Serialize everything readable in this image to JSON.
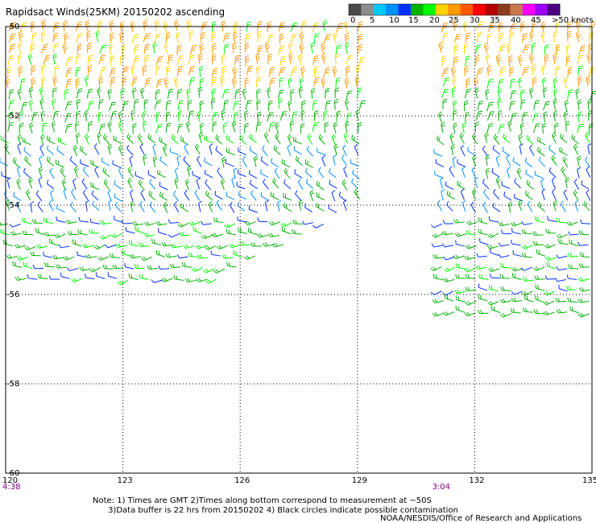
{
  "title": "Rapidsact Winds(25KM) 20150202 ascending",
  "legend": {
    "colors": [
      "#4a4a4a",
      "#8c8c8c",
      "#00c8ff",
      "#0090ff",
      "#0030ff",
      "#00b400",
      "#00ff00",
      "#ffd200",
      "#ff9a00",
      "#ff5a00",
      "#ff0000",
      "#b40000",
      "#8c3c1e",
      "#c87850",
      "#ff00ff",
      "#a000ff",
      "#4b0082"
    ],
    "labels": [
      "0",
      "5",
      "10",
      "15",
      "20",
      "25",
      "30",
      "35",
      "40",
      "45",
      ">50 knots"
    ]
  },
  "axes": {
    "lat_labels": [
      "-50",
      "-52",
      "-54",
      "-56",
      "-58",
      "-60"
    ],
    "lon_labels": [
      "120",
      "123",
      "126",
      "129",
      "132",
      "135"
    ]
  },
  "times": [
    "4:38",
    "3:04"
  ],
  "note_lines": [
    "Note: 1) Times are GMT 2)Times along bottom correspond to measurement at ~50S",
    "      3)Data buffer is 22 hrs from 20150202 4) Black circles indicate possible contamination"
  ],
  "credit": "NOAA/NESDIS/Office of Research and Applications",
  "chart_data": {
    "type": "wind-barb-map",
    "x_range": [
      120,
      135
    ],
    "y_range": [
      -60,
      -50
    ],
    "grid": true,
    "swaths": [
      {
        "region": "west",
        "lon_range": [
          120,
          129.2
        ],
        "lat_range_north": -50,
        "lat_range_south": -55.9
      },
      {
        "region": "east",
        "lon_range": [
          131.1,
          135
        ],
        "lat_range_north": -50,
        "lat_range_south": -56.5
      }
    ],
    "wind_bands": [
      {
        "lat_range": [
          -50,
          -51.6
        ],
        "speed_range_knots": [
          22,
          30
        ],
        "color_class": "yellow-orange"
      },
      {
        "lat_range": [
          -51.6,
          -52.8
        ],
        "speed_range_knots": [
          15,
          22
        ],
        "color_class": "green-yellow"
      },
      {
        "lat_range": [
          -52.8,
          -54.2
        ],
        "speed_range_knots": [
          8,
          18
        ],
        "color_class": "blue-black"
      },
      {
        "lat_range": [
          -54.2,
          -56
        ],
        "speed_range_knots": [
          12,
          22
        ],
        "color_class": "green"
      }
    ]
  }
}
